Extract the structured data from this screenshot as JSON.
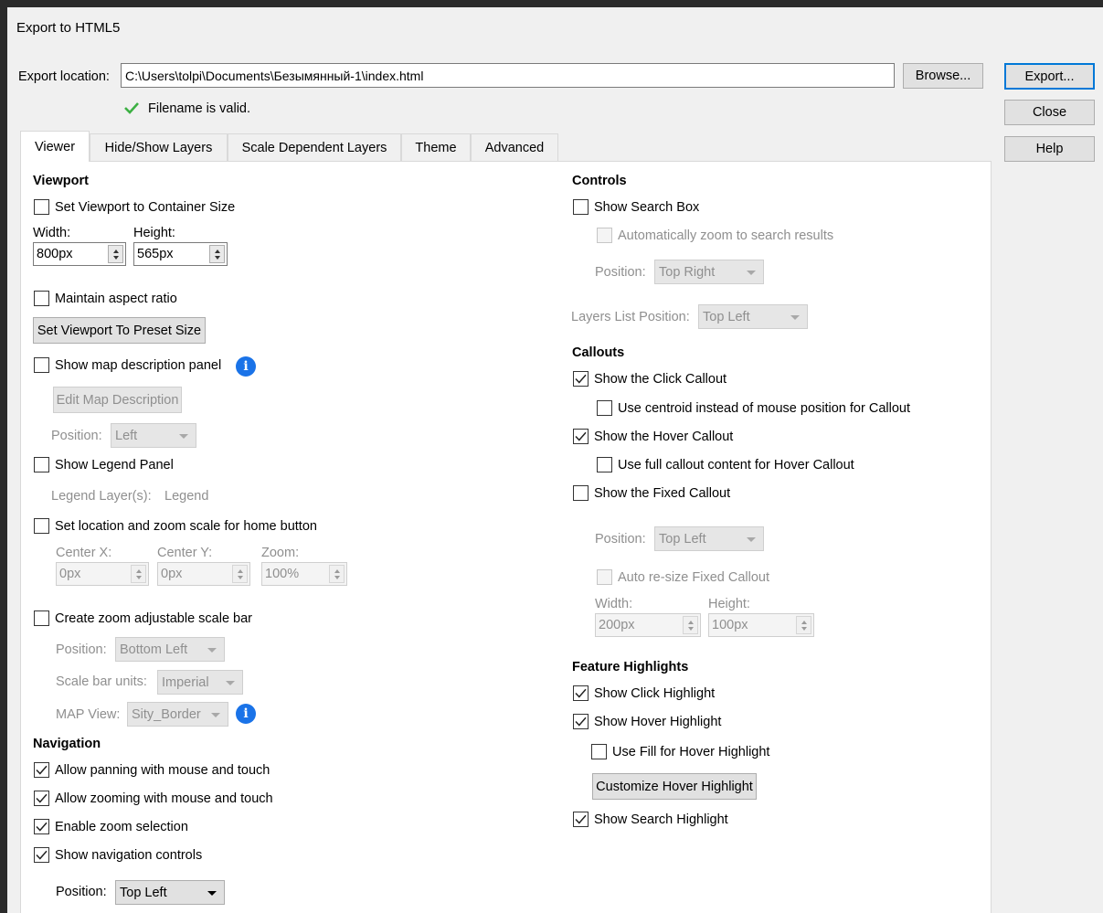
{
  "window": {
    "title": "Export to HTML5"
  },
  "export": {
    "location_label": "Export location:",
    "location_value": "C:\\Users\\tolpi\\Documents\\Безымянный-1\\index.html",
    "valid_message": "Filename is valid.",
    "browse_label": "Browse...",
    "export_label": "Export...",
    "close_label": "Close",
    "help_label": "Help"
  },
  "tabs": [
    "Viewer",
    "Hide/Show Layers",
    "Scale Dependent Layers",
    "Theme",
    "Advanced"
  ],
  "viewport": {
    "heading": "Viewport",
    "container_size_label": "Set Viewport to Container Size",
    "width_label": "Width:",
    "height_label": "Height:",
    "width_value": "800px",
    "height_value": "565px",
    "aspect_label": "Maintain aspect ratio",
    "preset_button": "Set Viewport To Preset Size",
    "map_desc_label": "Show map description panel",
    "edit_desc_button": "Edit Map Description",
    "position_label": "Position:",
    "position_value": "Left",
    "legend_label": "Show Legend Panel",
    "legend_layers_label": "Legend Layer(s):",
    "legend_layers_value": "Legend",
    "home_label": "Set location and zoom scale for home button",
    "center_x_label": "Center X:",
    "center_y_label": "Center Y:",
    "zoom_label": "Zoom:",
    "center_x_value": "0px",
    "center_y_value": "0px",
    "zoom_value": "100%",
    "scalebar_label": "Create zoom adjustable scale bar",
    "scalebar_position_label": "Position:",
    "scalebar_position_value": "Bottom Left",
    "scalebar_units_label": "Scale bar units:",
    "scalebar_units_value": "Imperial",
    "map_view_label": "MAP View:",
    "map_view_value": "Sity_Border"
  },
  "navigation": {
    "heading": "Navigation",
    "panning_label": "Allow panning with mouse and touch",
    "zooming_label": "Allow zooming with mouse and touch",
    "zoom_selection_label": "Enable zoom selection",
    "nav_controls_label": "Show navigation controls",
    "position_label": "Position:",
    "position_value": "Top Left"
  },
  "controls": {
    "heading": "Controls",
    "search_box_label": "Show Search Box",
    "auto_zoom_label": "Automatically zoom to search results",
    "position_label": "Position:",
    "position_value": "Top Right",
    "layers_list_label": "Layers List Position:",
    "layers_list_value": "Top Left"
  },
  "callouts": {
    "heading": "Callouts",
    "click_label": "Show the Click Callout",
    "centroid_label": "Use centroid instead of mouse position for Callout",
    "hover_label": "Show the Hover Callout",
    "full_content_label": "Use full callout content for Hover Callout",
    "fixed_label": "Show the Fixed Callout",
    "position_label": "Position:",
    "position_value": "Top Left",
    "auto_resize_label": "Auto re-size Fixed Callout",
    "width_label": "Width:",
    "height_label": "Height:",
    "width_value": "200px",
    "height_value": "100px"
  },
  "highlights": {
    "heading": "Feature Highlights",
    "click_label": "Show Click Highlight",
    "hover_label": "Show Hover Highlight",
    "fill_label": "Use Fill for Hover Highlight",
    "customize_button": "Customize Hover Highlight",
    "search_label": "Show Search Highlight"
  },
  "colors": {
    "accent": "#0078d7",
    "valid_check": "#3cb043",
    "info": "#1a73e8"
  }
}
